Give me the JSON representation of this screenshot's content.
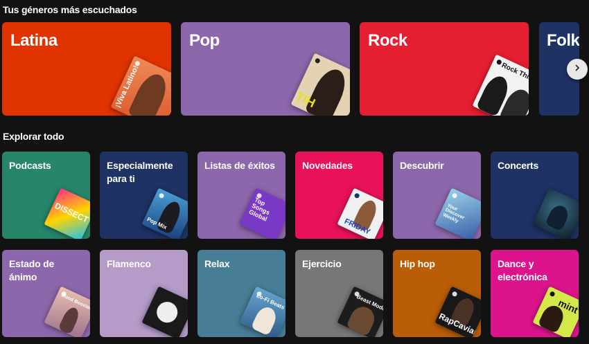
{
  "top_genres": {
    "title": "Tus géneros más escuchados",
    "cards": [
      {
        "label": "Latina",
        "color": "#e13300",
        "cover_text": "¡Viva Latino!"
      },
      {
        "label": "Pop",
        "color": "#8d67ab",
        "cover_text": "TIH"
      },
      {
        "label": "Rock",
        "color": "#e61e32",
        "cover_text": "Rock This"
      },
      {
        "label": "Folk",
        "color": "#1e3264"
      }
    ],
    "next_icon": "chevron-right-icon"
  },
  "browse": {
    "title": "Explorar todo",
    "tiles": [
      {
        "label": "Podcasts",
        "color": "#27856a",
        "cover_text": "DISSECT"
      },
      {
        "label": "Especialmente para ti",
        "color": "#1e3264",
        "cover_text": "Pop Mix"
      },
      {
        "label": "Listas de éxitos",
        "color": "#8d67ab",
        "cover_text": "Top Songs Global"
      },
      {
        "label": "Novedades",
        "color": "#e8115b",
        "cover_text": "FRIDAY"
      },
      {
        "label": "Descubrir",
        "color": "#8d67ab",
        "cover_text": "Your Discover Weekly"
      },
      {
        "label": "Concerts",
        "color": "#1e3264",
        "cover_text": ""
      },
      {
        "label": "Estado de ánimo",
        "color": "#8d67ab",
        "cover_text": "Mood Booster"
      },
      {
        "label": "Flamenco",
        "color": "#b49bc8",
        "cover_text": ""
      },
      {
        "label": "Relax",
        "color": "#477d95",
        "cover_text": "Lo-Fi Beats"
      },
      {
        "label": "Ejercicio",
        "color": "#777777",
        "cover_text": "Beast Mode"
      },
      {
        "label": "Hip hop",
        "color": "#ba5d07",
        "cover_text": "RapCaviar"
      },
      {
        "label": "Dance y electrónica",
        "color": "#dc148c",
        "cover_text": "mint"
      }
    ]
  }
}
